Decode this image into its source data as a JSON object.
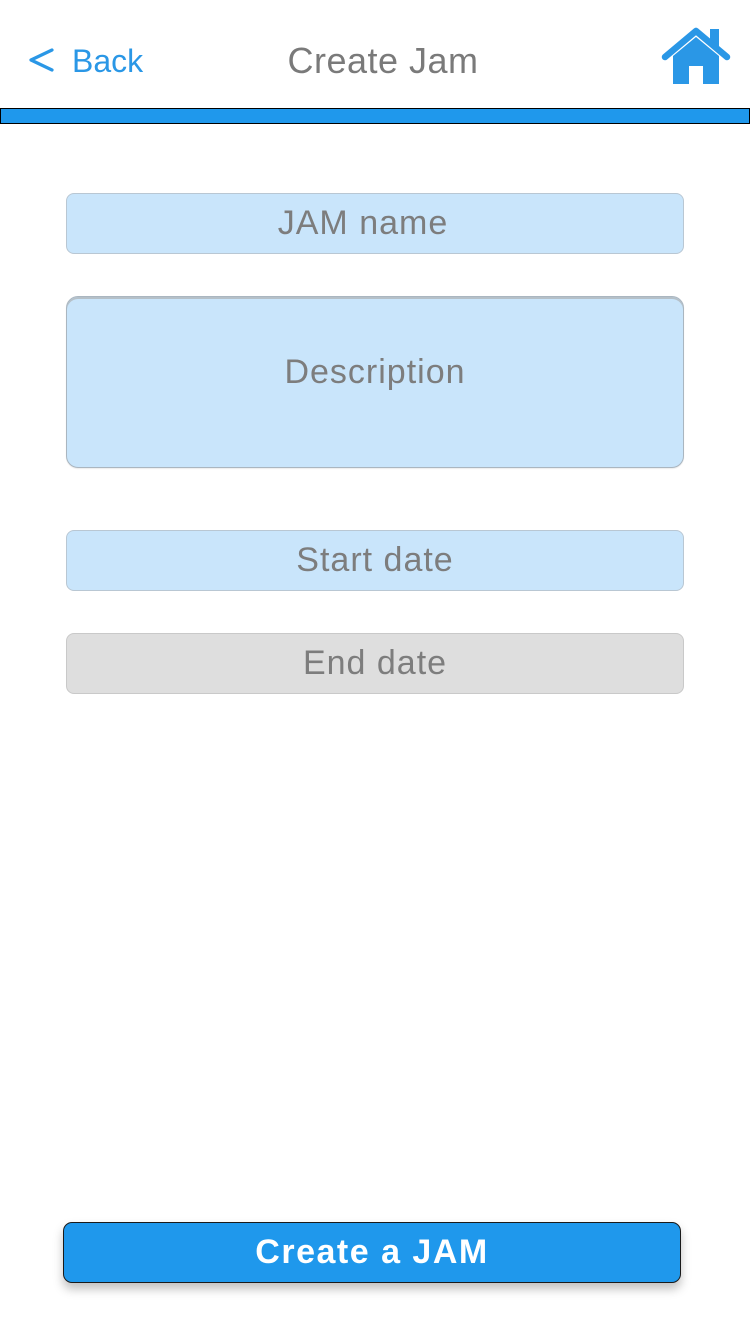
{
  "navbar": {
    "back_label": "Back",
    "title": "Create Jam",
    "back_icon": "chevron-left-icon",
    "home_icon": "home-icon"
  },
  "form": {
    "jam_name_placeholder": "JAM name",
    "description_placeholder": "Description",
    "start_date_placeholder": "Start date",
    "end_date_placeholder": "End date"
  },
  "actions": {
    "create_label": "Create a JAM"
  },
  "colors": {
    "accent": "#1f98ec",
    "link": "#2a97e6",
    "field_active": "#c9e5fb",
    "field_disabled": "#dedede",
    "placeholder_text": "#7d7d7d"
  }
}
